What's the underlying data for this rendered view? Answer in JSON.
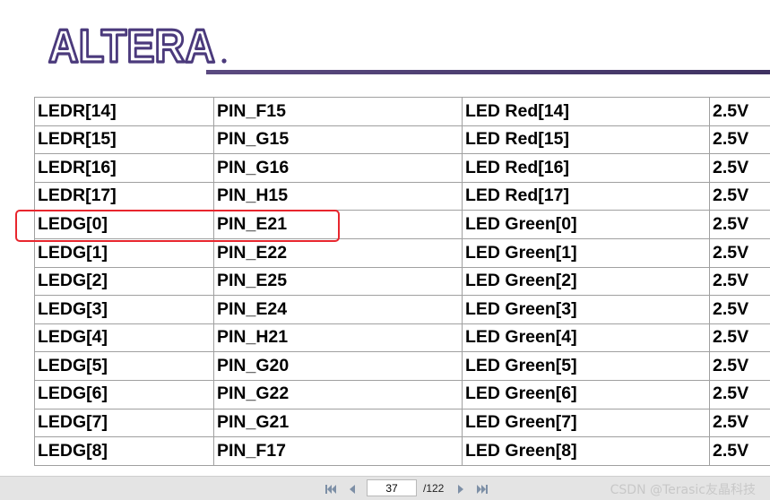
{
  "logo": {
    "text": "ALTERA"
  },
  "table": {
    "rows": [
      [
        "LEDR[14]",
        "PIN_F15",
        "LED Red[14]",
        "2.5V"
      ],
      [
        "LEDR[15]",
        "PIN_G15",
        "LED Red[15]",
        "2.5V"
      ],
      [
        "LEDR[16]",
        "PIN_G16",
        "LED Red[16]",
        "2.5V"
      ],
      [
        "LEDR[17]",
        "PIN_H15",
        "LED Red[17]",
        "2.5V"
      ],
      [
        "LEDG[0]",
        "PIN_E21",
        "LED Green[0]",
        "2.5V"
      ],
      [
        "LEDG[1]",
        "PIN_E22",
        "LED Green[1]",
        "2.5V"
      ],
      [
        "LEDG[2]",
        "PIN_E25",
        "LED Green[2]",
        "2.5V"
      ],
      [
        "LEDG[3]",
        "PIN_E24",
        "LED Green[3]",
        "2.5V"
      ],
      [
        "LEDG[4]",
        "PIN_H21",
        "LED Green[4]",
        "2.5V"
      ],
      [
        "LEDG[5]",
        "PIN_G20",
        "LED Green[5]",
        "2.5V"
      ],
      [
        "LEDG[6]",
        "PIN_G22",
        "LED Green[6]",
        "2.5V"
      ],
      [
        "LEDG[7]",
        "PIN_G21",
        "LED Green[7]",
        "2.5V"
      ],
      [
        "LEDG[8]",
        "PIN_F17",
        "LED Green[8]",
        "2.5V"
      ]
    ],
    "highlighted_row": 4,
    "highlight_color": "#e8262e"
  },
  "viewer": {
    "current_page": "37",
    "total_pages": "/122",
    "icons": [
      "first-page-icon",
      "previous-page-icon",
      "next-page-icon",
      "last-page-icon"
    ]
  },
  "watermark": "CSDN @Terasic友晶科技",
  "colors": {
    "logo": "#4b3a7c",
    "header_rule": "#4a3c6e",
    "toolbar": "#e4e4e4"
  }
}
